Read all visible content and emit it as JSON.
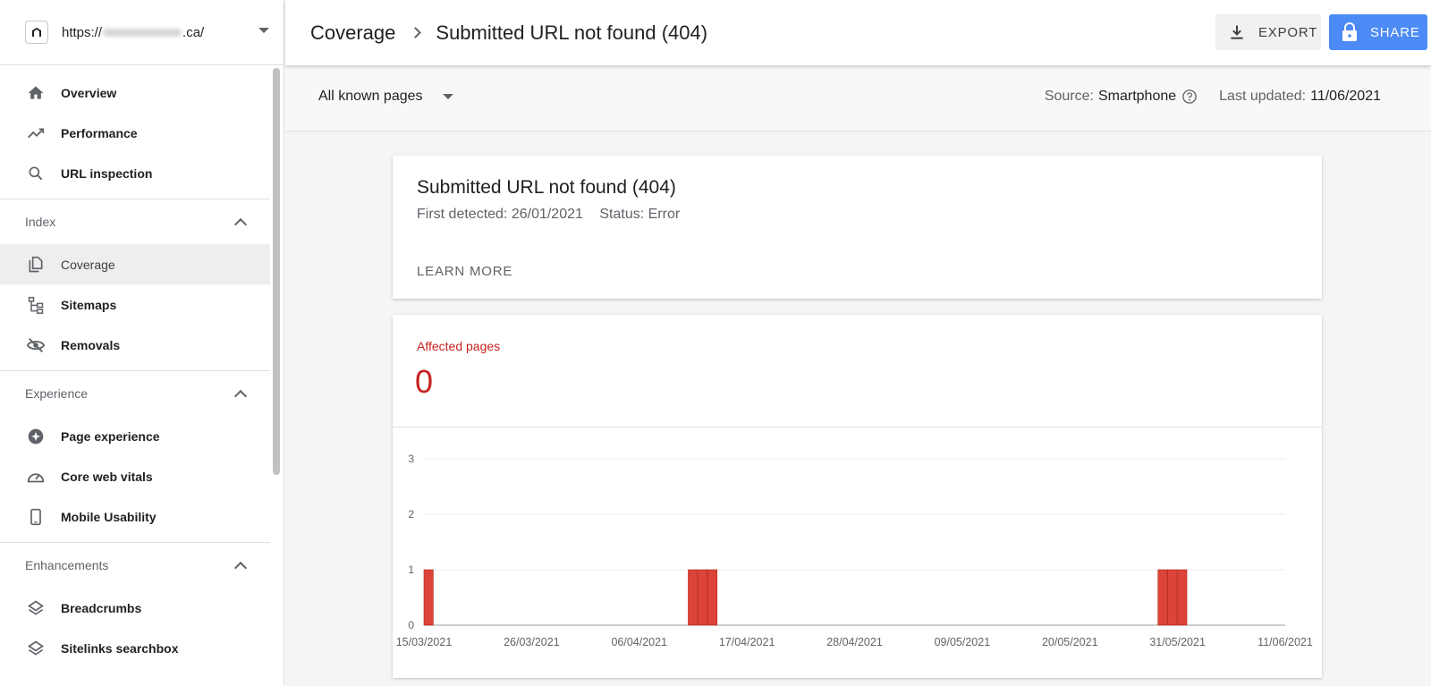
{
  "sidebar": {
    "site": {
      "url_prefix": "https://",
      "url_suffix": ".ca/"
    },
    "top_items": [
      {
        "label": "Overview",
        "icon": "home-icon"
      },
      {
        "label": "Performance",
        "icon": "trending-up-icon"
      },
      {
        "label": "URL inspection",
        "icon": "search-icon"
      }
    ],
    "sections": [
      {
        "title": "Index",
        "items": [
          {
            "label": "Coverage",
            "icon": "coverage-icon",
            "active": true
          },
          {
            "label": "Sitemaps",
            "icon": "sitemap-icon"
          },
          {
            "label": "Removals",
            "icon": "eye-off-icon"
          }
        ]
      },
      {
        "title": "Experience",
        "items": [
          {
            "label": "Page experience",
            "icon": "page-experience-icon"
          },
          {
            "label": "Core web vitals",
            "icon": "gauge-icon"
          },
          {
            "label": "Mobile Usability",
            "icon": "phone-icon"
          }
        ]
      },
      {
        "title": "Enhancements",
        "items": [
          {
            "label": "Breadcrumbs",
            "icon": "layers-icon"
          },
          {
            "label": "Sitelinks searchbox",
            "icon": "layers-icon"
          }
        ]
      }
    ]
  },
  "header": {
    "crumb_root": "Coverage",
    "crumb_current": "Submitted URL not found (404)",
    "export_label": "EXPORT",
    "share_label": "SHARE"
  },
  "filter": {
    "selected": "All known pages",
    "source_label": "Source:",
    "source_value": "Smartphone",
    "updated_label": "Last updated:",
    "updated_value": "11/06/2021"
  },
  "issue": {
    "title": "Submitted URL not found (404)",
    "first_detected": "First detected: 26/01/2021",
    "status": "Status: Error",
    "learn_more": "LEARN MORE"
  },
  "affected": {
    "label": "Affected pages",
    "value": "0"
  },
  "colors": {
    "bar": "#db4437",
    "error": "#c5221f",
    "primary": "#4c8bf5"
  },
  "chart_data": {
    "type": "bar",
    "x_start": "15/03/2021",
    "x_end": "11/06/2021",
    "x_ticks": [
      "15/03/2021",
      "26/03/2021",
      "06/04/2021",
      "17/04/2021",
      "28/04/2021",
      "09/05/2021",
      "20/05/2021",
      "31/05/2021",
      "11/06/2021"
    ],
    "y_ticks": [
      0,
      1,
      2,
      3
    ],
    "ylim": [
      0,
      3
    ],
    "grid": true,
    "bars": [
      {
        "date": "15/03/2021",
        "value": 1
      },
      {
        "date": "11/04/2021",
        "value": 1
      },
      {
        "date": "12/04/2021",
        "value": 1
      },
      {
        "date": "13/04/2021",
        "value": 1
      },
      {
        "date": "29/05/2021",
        "value": 1
      },
      {
        "date": "30/05/2021",
        "value": 1
      },
      {
        "date": "31/05/2021",
        "value": 1
      }
    ]
  }
}
